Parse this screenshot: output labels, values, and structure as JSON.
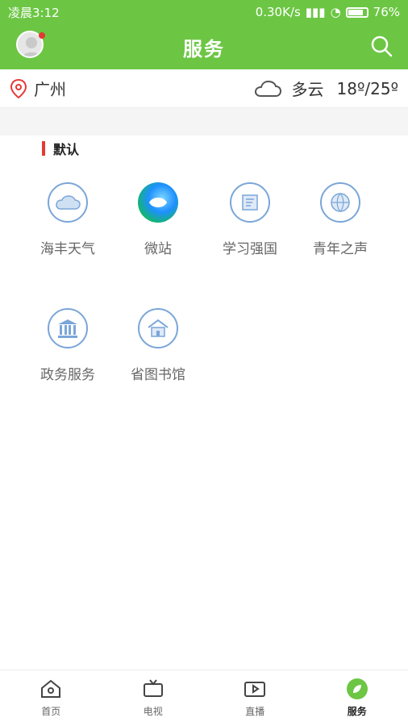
{
  "status_bar": {
    "time": "凌晨3:12",
    "network_speed": "0.30K/s",
    "battery": "76%"
  },
  "header": {
    "title": "服务"
  },
  "location": {
    "city": "广州",
    "weather": "多云",
    "temp": "18º/25º"
  },
  "section": {
    "title": "默认"
  },
  "services": [
    {
      "label": "海丰天气",
      "icon": "cloud-icon"
    },
    {
      "label": "微站",
      "icon": "weizhan-logo-icon"
    },
    {
      "label": "学习强国",
      "icon": "xuexi-icon"
    },
    {
      "label": "青年之声",
      "icon": "globe-icon"
    },
    {
      "label": "政务服务",
      "icon": "government-building-icon"
    },
    {
      "label": "省图书馆",
      "icon": "library-house-icon"
    }
  ],
  "bottom_nav": [
    {
      "label": "首页",
      "icon": "home-icon"
    },
    {
      "label": "电视",
      "icon": "tv-icon"
    },
    {
      "label": "直播",
      "icon": "live-video-icon"
    },
    {
      "label": "服务",
      "icon": "service-leaf-icon",
      "active": true
    }
  ],
  "colors": {
    "brand_green": "#6cc644",
    "accent_red": "#e53935",
    "icon_blue": "#7aa6d8"
  }
}
